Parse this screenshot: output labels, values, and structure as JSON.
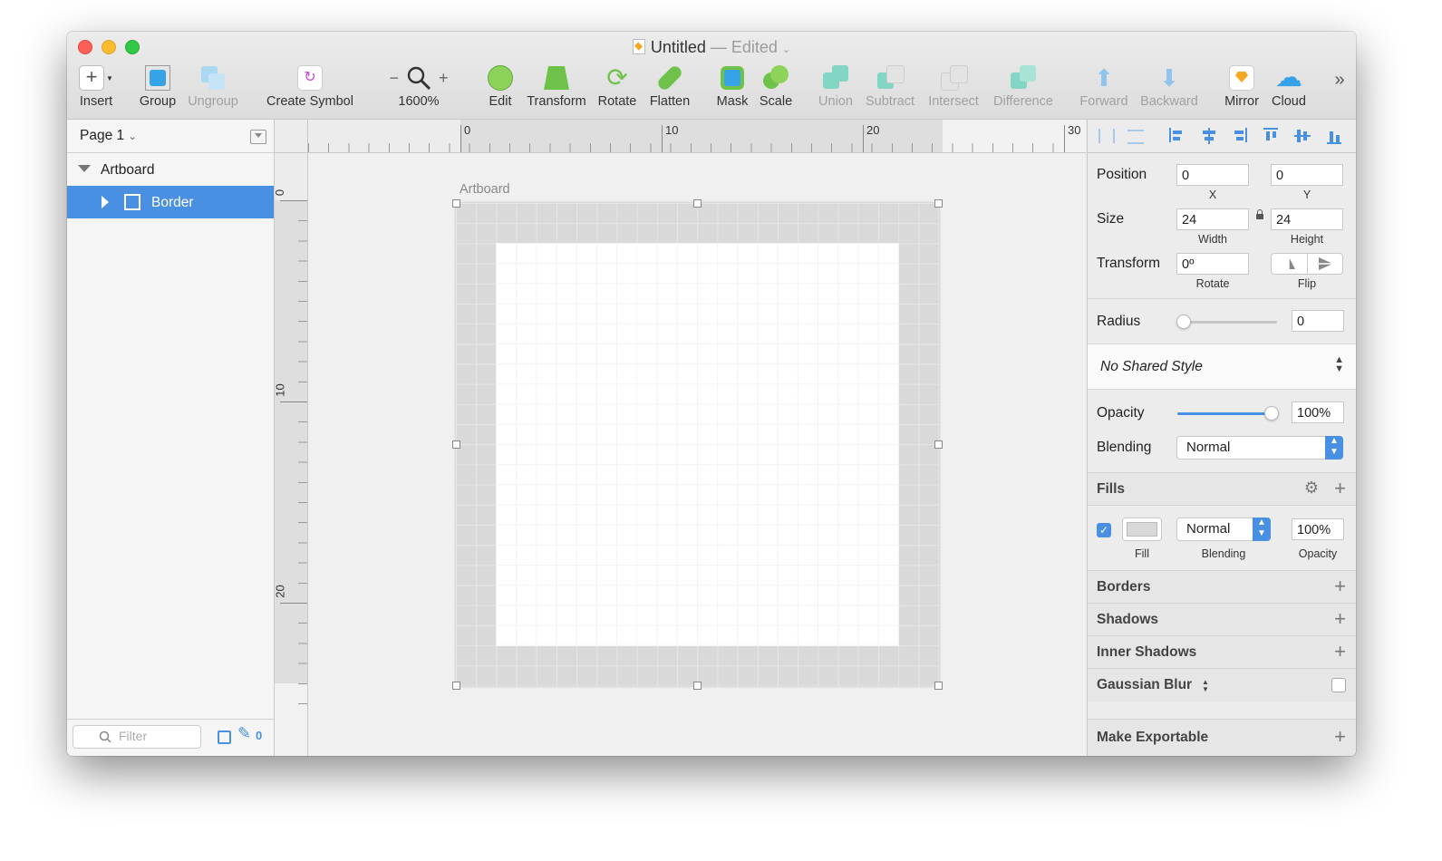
{
  "window": {
    "title": "Untitled",
    "edited": "— Edited"
  },
  "toolbar": {
    "insert": "Insert",
    "group": "Group",
    "ungroup": "Ungroup",
    "create_symbol": "Create Symbol",
    "zoom_minus": "−",
    "zoom_plus": "+",
    "zoom": "1600%",
    "edit": "Edit",
    "transform": "Transform",
    "rotate": "Rotate",
    "flatten": "Flatten",
    "mask": "Mask",
    "scale": "Scale",
    "union": "Union",
    "subtract": "Subtract",
    "intersect": "Intersect",
    "difference": "Difference",
    "forward": "Forward",
    "backward": "Backward",
    "mirror": "Mirror",
    "cloud": "Cloud",
    "more": "»"
  },
  "sidebar": {
    "page": "Page 1",
    "layers": [
      {
        "label": "Artboard",
        "selected": false
      },
      {
        "label": "Border",
        "selected": true
      }
    ],
    "filter_placeholder": "Filter",
    "count": "0"
  },
  "rulers": {
    "horizontal": [
      "0",
      "10",
      "20",
      "30"
    ],
    "vertical": [
      "0",
      "10",
      "20"
    ]
  },
  "canvas": {
    "artboard_label": "Artboard"
  },
  "inspector": {
    "position": {
      "label": "Position",
      "x": "0",
      "y": "0",
      "x_label": "X",
      "y_label": "Y"
    },
    "size": {
      "label": "Size",
      "width": "24",
      "height": "24",
      "width_label": "Width",
      "height_label": "Height"
    },
    "transform": {
      "label": "Transform",
      "rotate": "0º",
      "rotate_label": "Rotate",
      "flip_label": "Flip"
    },
    "radius": {
      "label": "Radius",
      "value": "0"
    },
    "shared_style": "No Shared Style",
    "opacity": {
      "label": "Opacity",
      "value": "100%",
      "level": 1.0
    },
    "blending": {
      "label": "Blending",
      "value": "Normal"
    },
    "fills": {
      "label": "Fills",
      "fill_label": "Fill",
      "blending": "Normal",
      "blending_label": "Blending",
      "opacity": "100%",
      "opacity_label": "Opacity"
    },
    "borders": "Borders",
    "shadows": "Shadows",
    "inner_shadows": "Inner Shadows",
    "gaussian_blur": "Gaussian Blur",
    "make_exportable": "Make Exportable"
  },
  "colors": {
    "accent": "#4a90e2",
    "selection": "#4a90e2"
  }
}
